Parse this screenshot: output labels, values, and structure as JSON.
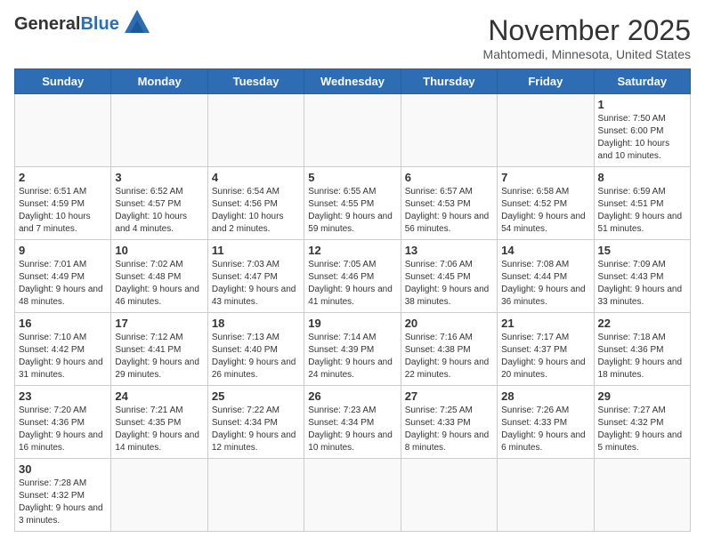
{
  "header": {
    "logo_general": "General",
    "logo_blue": "Blue",
    "month_title": "November 2025",
    "location": "Mahtomedi, Minnesota, United States"
  },
  "days_of_week": [
    "Sunday",
    "Monday",
    "Tuesday",
    "Wednesday",
    "Thursday",
    "Friday",
    "Saturday"
  ],
  "weeks": [
    {
      "days": [
        {
          "num": "",
          "info": ""
        },
        {
          "num": "",
          "info": ""
        },
        {
          "num": "",
          "info": ""
        },
        {
          "num": "",
          "info": ""
        },
        {
          "num": "",
          "info": ""
        },
        {
          "num": "",
          "info": ""
        },
        {
          "num": "1",
          "info": "Sunrise: 7:50 AM\nSunset: 6:00 PM\nDaylight: 10 hours and 10 minutes."
        }
      ]
    },
    {
      "days": [
        {
          "num": "2",
          "info": "Sunrise: 6:51 AM\nSunset: 4:59 PM\nDaylight: 10 hours and 7 minutes."
        },
        {
          "num": "3",
          "info": "Sunrise: 6:52 AM\nSunset: 4:57 PM\nDaylight: 10 hours and 4 minutes."
        },
        {
          "num": "4",
          "info": "Sunrise: 6:54 AM\nSunset: 4:56 PM\nDaylight: 10 hours and 2 minutes."
        },
        {
          "num": "5",
          "info": "Sunrise: 6:55 AM\nSunset: 4:55 PM\nDaylight: 9 hours and 59 minutes."
        },
        {
          "num": "6",
          "info": "Sunrise: 6:57 AM\nSunset: 4:53 PM\nDaylight: 9 hours and 56 minutes."
        },
        {
          "num": "7",
          "info": "Sunrise: 6:58 AM\nSunset: 4:52 PM\nDaylight: 9 hours and 54 minutes."
        },
        {
          "num": "8",
          "info": "Sunrise: 6:59 AM\nSunset: 4:51 PM\nDaylight: 9 hours and 51 minutes."
        }
      ]
    },
    {
      "days": [
        {
          "num": "9",
          "info": "Sunrise: 7:01 AM\nSunset: 4:49 PM\nDaylight: 9 hours and 48 minutes."
        },
        {
          "num": "10",
          "info": "Sunrise: 7:02 AM\nSunset: 4:48 PM\nDaylight: 9 hours and 46 minutes."
        },
        {
          "num": "11",
          "info": "Sunrise: 7:03 AM\nSunset: 4:47 PM\nDaylight: 9 hours and 43 minutes."
        },
        {
          "num": "12",
          "info": "Sunrise: 7:05 AM\nSunset: 4:46 PM\nDaylight: 9 hours and 41 minutes."
        },
        {
          "num": "13",
          "info": "Sunrise: 7:06 AM\nSunset: 4:45 PM\nDaylight: 9 hours and 38 minutes."
        },
        {
          "num": "14",
          "info": "Sunrise: 7:08 AM\nSunset: 4:44 PM\nDaylight: 9 hours and 36 minutes."
        },
        {
          "num": "15",
          "info": "Sunrise: 7:09 AM\nSunset: 4:43 PM\nDaylight: 9 hours and 33 minutes."
        }
      ]
    },
    {
      "days": [
        {
          "num": "16",
          "info": "Sunrise: 7:10 AM\nSunset: 4:42 PM\nDaylight: 9 hours and 31 minutes."
        },
        {
          "num": "17",
          "info": "Sunrise: 7:12 AM\nSunset: 4:41 PM\nDaylight: 9 hours and 29 minutes."
        },
        {
          "num": "18",
          "info": "Sunrise: 7:13 AM\nSunset: 4:40 PM\nDaylight: 9 hours and 26 minutes."
        },
        {
          "num": "19",
          "info": "Sunrise: 7:14 AM\nSunset: 4:39 PM\nDaylight: 9 hours and 24 minutes."
        },
        {
          "num": "20",
          "info": "Sunrise: 7:16 AM\nSunset: 4:38 PM\nDaylight: 9 hours and 22 minutes."
        },
        {
          "num": "21",
          "info": "Sunrise: 7:17 AM\nSunset: 4:37 PM\nDaylight: 9 hours and 20 minutes."
        },
        {
          "num": "22",
          "info": "Sunrise: 7:18 AM\nSunset: 4:36 PM\nDaylight: 9 hours and 18 minutes."
        }
      ]
    },
    {
      "days": [
        {
          "num": "23",
          "info": "Sunrise: 7:20 AM\nSunset: 4:36 PM\nDaylight: 9 hours and 16 minutes."
        },
        {
          "num": "24",
          "info": "Sunrise: 7:21 AM\nSunset: 4:35 PM\nDaylight: 9 hours and 14 minutes."
        },
        {
          "num": "25",
          "info": "Sunrise: 7:22 AM\nSunset: 4:34 PM\nDaylight: 9 hours and 12 minutes."
        },
        {
          "num": "26",
          "info": "Sunrise: 7:23 AM\nSunset: 4:34 PM\nDaylight: 9 hours and 10 minutes."
        },
        {
          "num": "27",
          "info": "Sunrise: 7:25 AM\nSunset: 4:33 PM\nDaylight: 9 hours and 8 minutes."
        },
        {
          "num": "28",
          "info": "Sunrise: 7:26 AM\nSunset: 4:33 PM\nDaylight: 9 hours and 6 minutes."
        },
        {
          "num": "29",
          "info": "Sunrise: 7:27 AM\nSunset: 4:32 PM\nDaylight: 9 hours and 5 minutes."
        }
      ]
    },
    {
      "days": [
        {
          "num": "30",
          "info": "Sunrise: 7:28 AM\nSunset: 4:32 PM\nDaylight: 9 hours and 3 minutes."
        },
        {
          "num": "",
          "info": ""
        },
        {
          "num": "",
          "info": ""
        },
        {
          "num": "",
          "info": ""
        },
        {
          "num": "",
          "info": ""
        },
        {
          "num": "",
          "info": ""
        },
        {
          "num": "",
          "info": ""
        }
      ]
    }
  ]
}
